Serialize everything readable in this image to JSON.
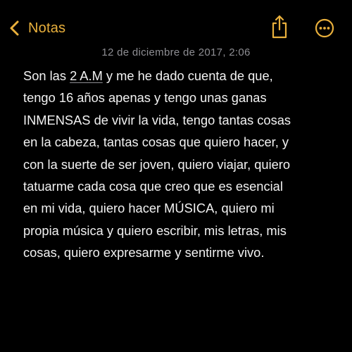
{
  "colors": {
    "background": "#000000",
    "accent": "#E9B03C",
    "text": "#F2F2F2",
    "secondary_text": "#8E8E93"
  },
  "nav": {
    "back_label": "Notas",
    "back_icon": "chevron-left-icon",
    "share_icon": "share-icon",
    "more_icon": "ellipsis-circle-icon"
  },
  "note": {
    "date": "12 de diciembre de 2017, 2:06",
    "line1_before": "Son las ",
    "line1_link": "2 A.M",
    "line1_after": " y me he dado cuenta de que,",
    "line2": "tengo 16 años apenas y tengo unas ganas",
    "line3": "INMENSAS de vivir la vida, tengo tantas cosas",
    "line4": "en la cabeza, tantas cosas que quiero hacer, y",
    "line5": "con la suerte de ser joven, quiero viajar, quiero",
    "line6": "tatuarme cada cosa que creo que es esencial",
    "line7": "en mi vida, quiero hacer MÚSICA, quiero mi",
    "line8": "propia música y quiero escribir, mis letras, mis",
    "line9": "cosas, quiero expresarme y sentirme vivo."
  }
}
